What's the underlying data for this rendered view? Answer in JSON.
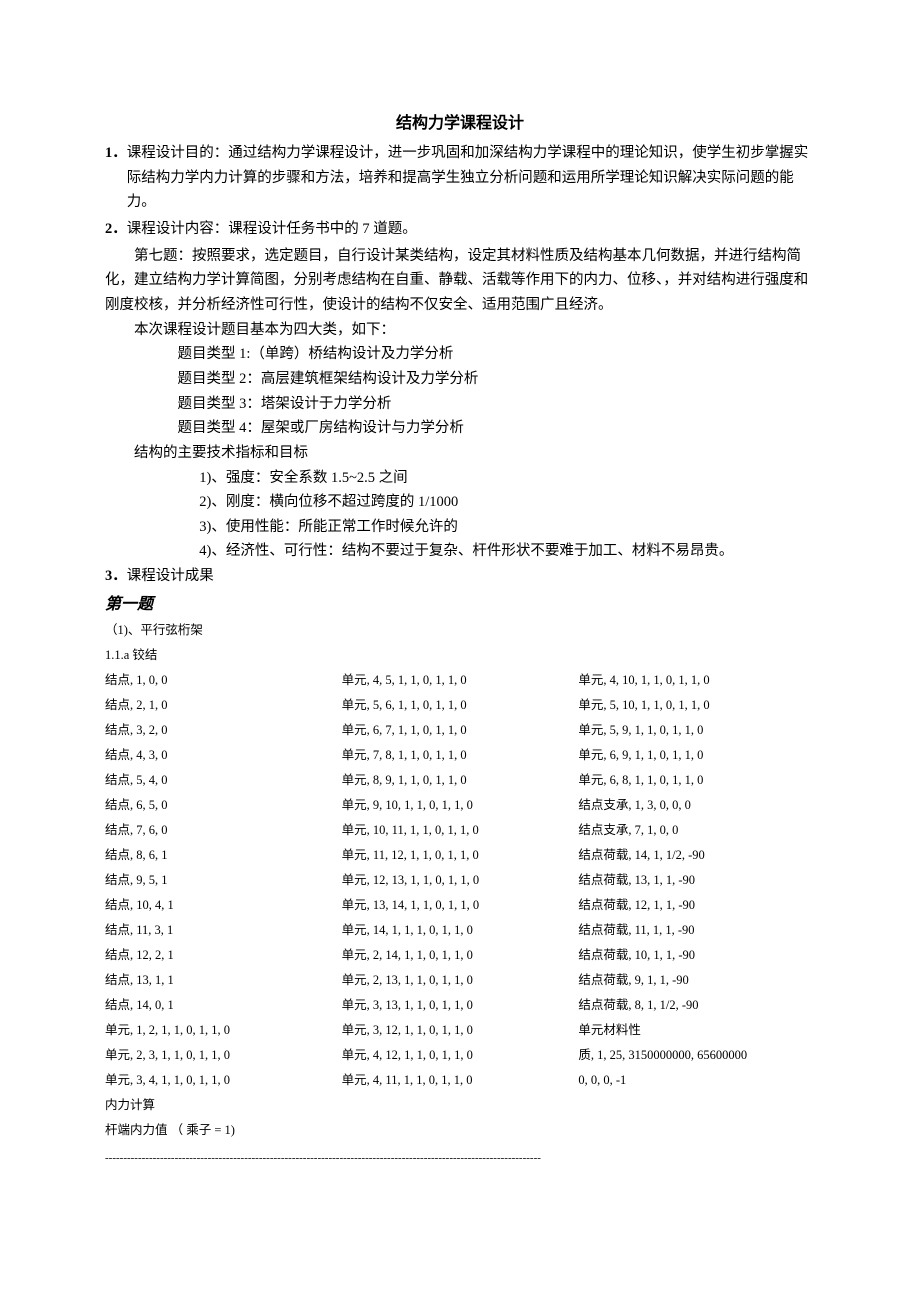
{
  "title": "结构力学课程设计",
  "s1": {
    "num": "1．",
    "text": "课程设计目的：通过结构力学课程设计，进一步巩固和加深结构力学课程中的理论知识，使学生初步掌握实际结构力学内力计算的步骤和方法，培养和提高学生独立分析问题和运用所学理论知识解决实际问题的能力。"
  },
  "s2": {
    "num": "2．",
    "text": "课程设计内容：课程设计任务书中的 7 道题。",
    "p1": "第七题：按照要求，选定题目，自行设计某类结构，设定其材料性质及结构基本几何数据，并进行结构简化，建立结构力学计算简图，分别考虑结构在自重、静载、活载等作用下的内力、位移、，并对结构进行强度和刚度校核，并分析经济性可行性，使设计的结构不仅安全、适用范围广且经济。",
    "p2": "本次课程设计题目基本为四大类，如下：",
    "t1": "题目类型 1:（单跨）桥结构设计及力学分析",
    "t2": "题目类型 2：高层建筑框架结构设计及力学分析",
    "t3": "题目类型 3：塔架设计于力学分析",
    "t4": "题目类型 4：屋架或厂房结构设计与力学分析",
    "p3": "结构的主要技术指标和目标",
    "i1": "1)、强度：安全系数 1.5~2.5 之间",
    "i2": "2)、刚度：横向位移不超过跨度的 1/1000",
    "i3": "3)、使用性能：所能正常工作时候允许的",
    "i4": "4)、经济性、可行性：结构不要过于复杂、杆件形状不要难于加工、材料不易昂贵。"
  },
  "s3": {
    "num": "3．",
    "text": "课程设计成果"
  },
  "q1": {
    "heading": "第一题",
    "sub1": "（1)、平行弦桁架",
    "sub2": "1.1.a 铰结",
    "col1": [
      "结点, 1, 0, 0",
      "结点, 2, 1, 0",
      "结点, 3, 2, 0",
      "结点, 4, 3, 0",
      "结点, 5, 4, 0",
      "结点, 6, 5, 0",
      "结点, 7, 6, 0",
      "结点, 8, 6, 1",
      "结点, 9, 5, 1",
      "结点, 10, 4, 1",
      "结点, 11, 3, 1",
      "结点, 12, 2, 1",
      "结点, 13, 1, 1",
      "结点, 14, 0, 1",
      "单元, 1, 2, 1, 1, 0, 1, 1, 0",
      "单元, 2, 3, 1, 1, 0, 1, 1, 0",
      "单元, 3, 4, 1, 1, 0, 1, 1, 0"
    ],
    "col2": [
      "单元, 4, 5, 1, 1, 0, 1, 1, 0",
      "单元, 5, 6, 1, 1, 0, 1, 1, 0",
      "单元, 6, 7, 1, 1, 0, 1, 1, 0",
      "单元, 7, 8, 1, 1, 0, 1, 1, 0",
      "单元, 8, 9, 1, 1, 0, 1, 1, 0",
      "单元, 9, 10, 1, 1, 0, 1, 1, 0",
      "单元, 10, 11, 1, 1, 0, 1, 1, 0",
      "单元, 11, 12, 1, 1, 0, 1, 1, 0",
      "单元, 12, 13, 1, 1, 0, 1, 1, 0",
      "单元, 13, 14, 1, 1, 0, 1, 1, 0",
      "单元, 14, 1, 1, 1, 0, 1, 1, 0",
      "单元, 2, 14, 1, 1, 0, 1, 1, 0",
      "单元, 2, 13, 1, 1, 0, 1, 1, 0",
      "单元, 3, 13, 1, 1, 0, 1, 1, 0",
      "单元, 3, 12, 1, 1, 0, 1, 1, 0",
      "单元, 4, 12, 1, 1, 0, 1, 1, 0",
      "单元, 4, 11, 1, 1, 0, 1, 1, 0"
    ],
    "col3": [
      "单元, 4, 10, 1, 1, 0, 1, 1, 0",
      "单元, 5, 10, 1, 1, 0, 1, 1, 0",
      "单元, 5, 9, 1, 1, 0, 1, 1, 0",
      "单元, 6, 9, 1, 1, 0, 1, 1, 0",
      "单元, 6, 8, 1, 1, 0, 1, 1, 0",
      "结点支承, 1, 3, 0, 0, 0",
      "结点支承, 7, 1, 0, 0",
      "结点荷载, 14, 1, 1/2, -90",
      "结点荷载, 13, 1, 1, -90",
      "结点荷载, 12, 1, 1, -90",
      "结点荷载, 11, 1, 1, -90",
      "结点荷载, 10, 1, 1, -90",
      "结点荷载, 9, 1, 1, -90",
      "结点荷载, 8, 1, 1/2, -90",
      "单元材料性",
      "质, 1, 25, 3150000000, 65600000",
      "0, 0, 0, -1"
    ],
    "foot1": "内力计算",
    "foot2": "杆端内力值  （ 乘子 = 1)"
  }
}
